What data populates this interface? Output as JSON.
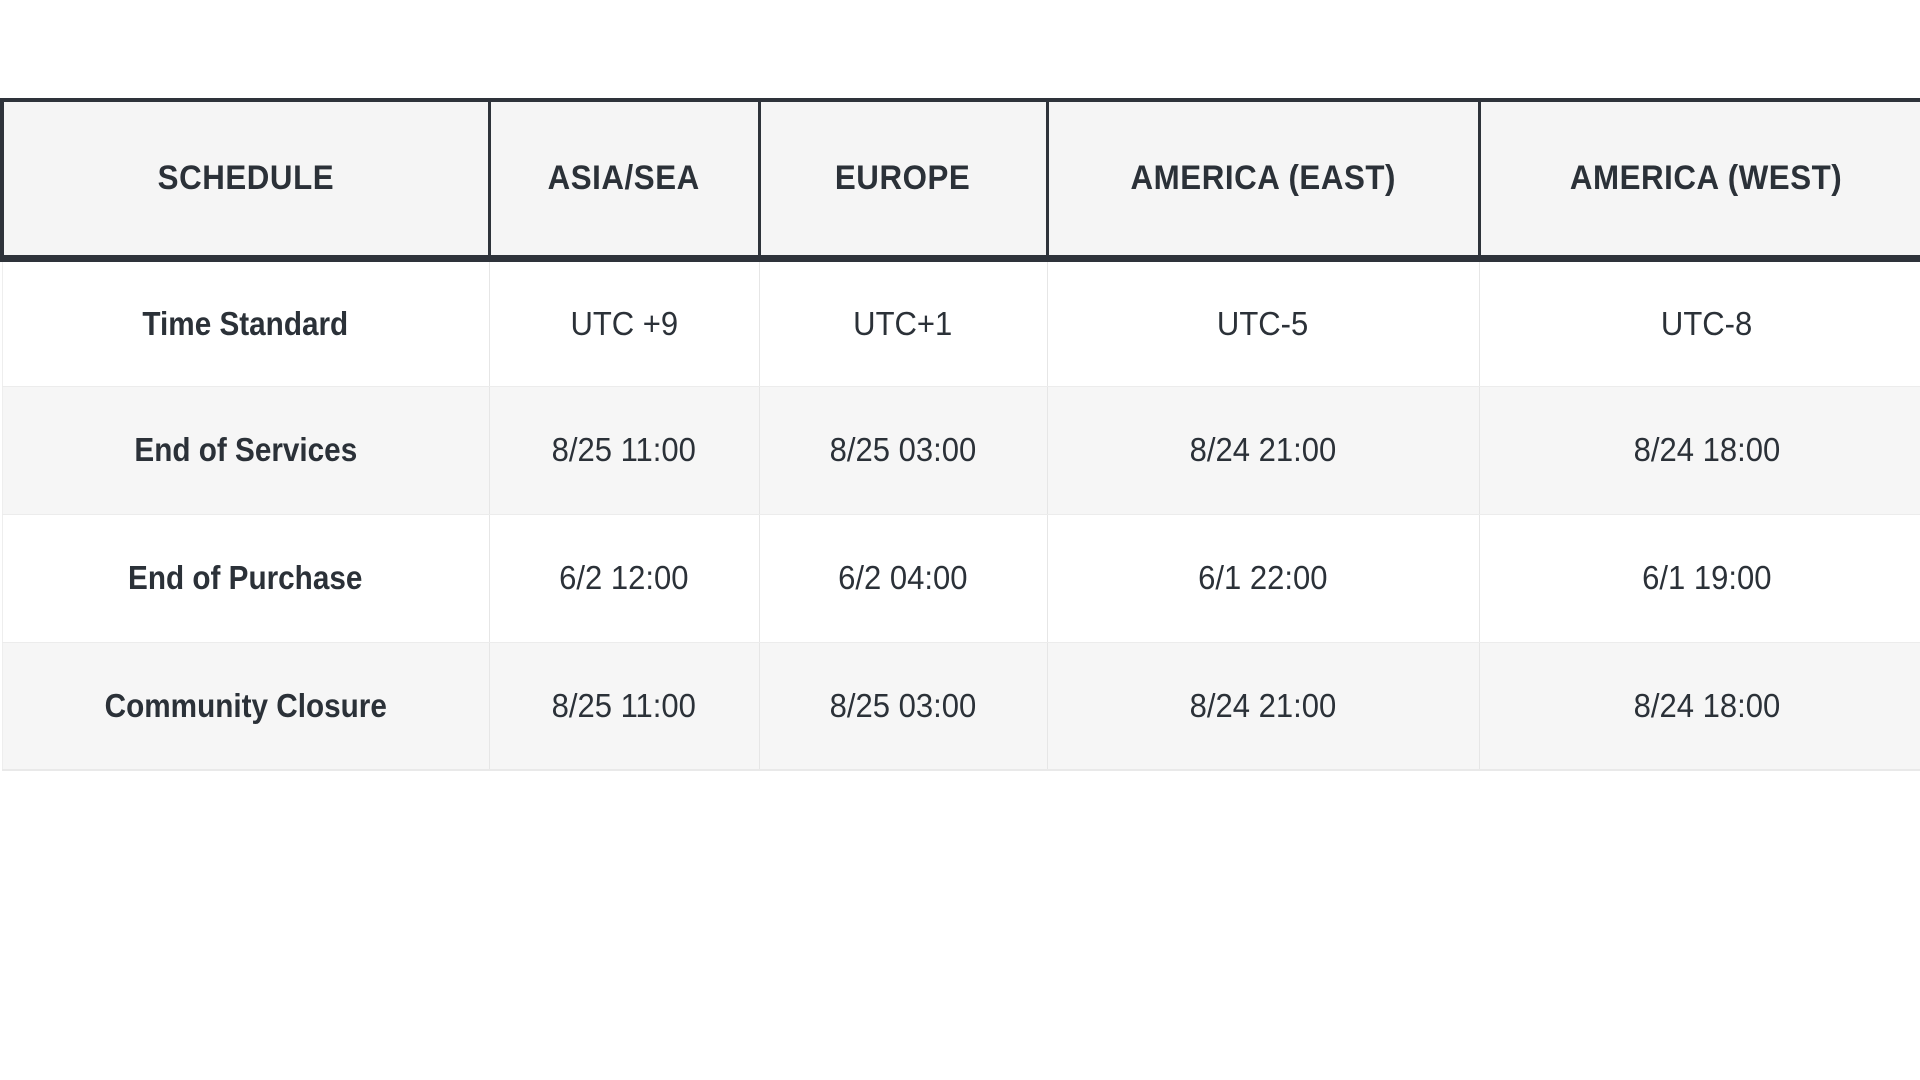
{
  "table": {
    "columns": [
      {
        "key": "schedule",
        "label": "SCHEDULE"
      },
      {
        "key": "asia_sea",
        "label": "ASIA/SEA"
      },
      {
        "key": "europe",
        "label": "EUROPE"
      },
      {
        "key": "america_east",
        "label": "AMERICA (EAST)"
      },
      {
        "key": "america_west",
        "label": "AMERICA (WEST)"
      }
    ],
    "rows": [
      {
        "label": "Time Standard",
        "asia_sea": "UTC +9",
        "europe": "UTC+1",
        "america_east": "UTC-5",
        "america_west": "UTC-8"
      },
      {
        "label": "End of Services",
        "asia_sea": "8/25 11:00",
        "europe": "8/25 03:00",
        "america_east": "8/24 21:00",
        "america_west": "8/24 18:00"
      },
      {
        "label": "End of Purchase",
        "asia_sea": "6/2 12:00",
        "europe": "6/2 04:00",
        "america_east": "6/1 22:00",
        "america_west": "6/1 19:00"
      },
      {
        "label": "Community Closure",
        "asia_sea": "8/25 11:00",
        "europe": "8/25 03:00",
        "america_east": "8/24 21:00",
        "america_west": "8/24 18:00"
      }
    ]
  },
  "colors": {
    "header_background": "#f5f5f5",
    "header_border": "#2e333a",
    "text": "#2b3138",
    "row_alt_background": "#f6f6f6",
    "row_background": "#ffffff",
    "grid_line": "#e6e6e6"
  }
}
